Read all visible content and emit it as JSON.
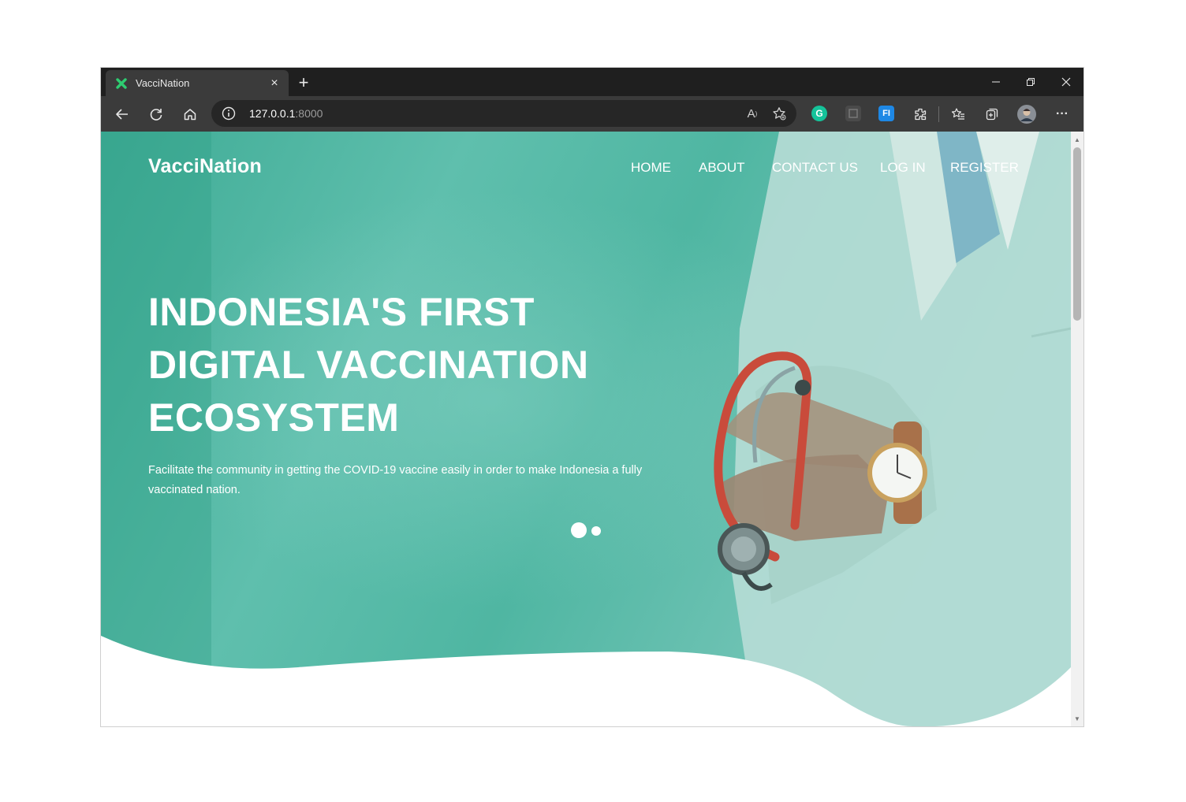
{
  "browser": {
    "tab_title": "VacciNation",
    "tab_close": "×",
    "new_tab": "+",
    "url_host": "127.0.0.1",
    "url_port": ":8000",
    "read_aloud": "A",
    "ext_grammarly": "G",
    "ext_fi": "FI",
    "more": "···"
  },
  "site": {
    "brand": "VacciNation",
    "nav": [
      "HOME",
      "ABOUT",
      "CONTACT US",
      "LOG IN",
      "REGISTER"
    ],
    "headline": [
      "INDONESIA'S FIRST",
      "DIGITAL VACCINATION",
      "ECOSYSTEM"
    ],
    "subtext": "Facilitate the community in getting the COVID-19 vaccine easily in order to make Indonesia a fully vaccinated nation.",
    "slider": {
      "slides": 2,
      "active": 1
    }
  },
  "colors": {
    "hero_teal": "#3fb39a",
    "brand_green": "#2ecc71"
  }
}
